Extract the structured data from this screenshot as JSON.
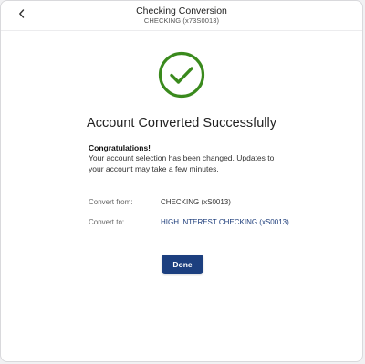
{
  "header": {
    "title": "Checking Conversion",
    "subtitle": "CHECKING (x73S0013)",
    "back_icon": "chevron-left-icon"
  },
  "status": {
    "icon": "check-circle-icon",
    "icon_color": "#3a8a1d",
    "heading": "Account Converted Successfully"
  },
  "message": {
    "title": "Congratulations!",
    "body": "Your account selection has been changed. Updates to your account may take a few minutes."
  },
  "details": {
    "convert_from_label": "Convert from:",
    "convert_from_value": "CHECKING (xS0013)",
    "convert_to_label": "Convert to:",
    "convert_to_value": "HIGH INTEREST CHECKING (xS0013)"
  },
  "actions": {
    "done_label": "Done",
    "accent_color": "#1c3f7f"
  }
}
